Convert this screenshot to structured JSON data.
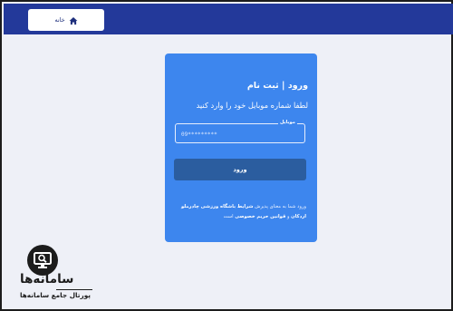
{
  "header": {
    "home_label": "خانه",
    "home_icon": "home-icon"
  },
  "login": {
    "title": "ورود | ثبت نام",
    "subtitle": "لطفا شماره موبایل خود را وارد کنید",
    "mobile_label": "موبایل",
    "mobile_placeholder": "09*********",
    "submit_label": "ورود",
    "terms_before": "ورود شما به معنای پذیرش",
    "terms_link_1": "شرایط باشگاه ورزشی چادرملو اردکان",
    "terms_middle": "و",
    "terms_link_2": "قوانین حریم خصوصی",
    "terms_after": "است"
  },
  "watermark": {
    "name": "سامانه‌ها",
    "tagline": "پورتال جامع سامانه‌ها",
    "icon": "monitor-search-icon"
  },
  "colors": {
    "topbar": "#23399a",
    "card": "#3d86ee",
    "button": "#2b5d9f",
    "background": "#eef0f7"
  }
}
